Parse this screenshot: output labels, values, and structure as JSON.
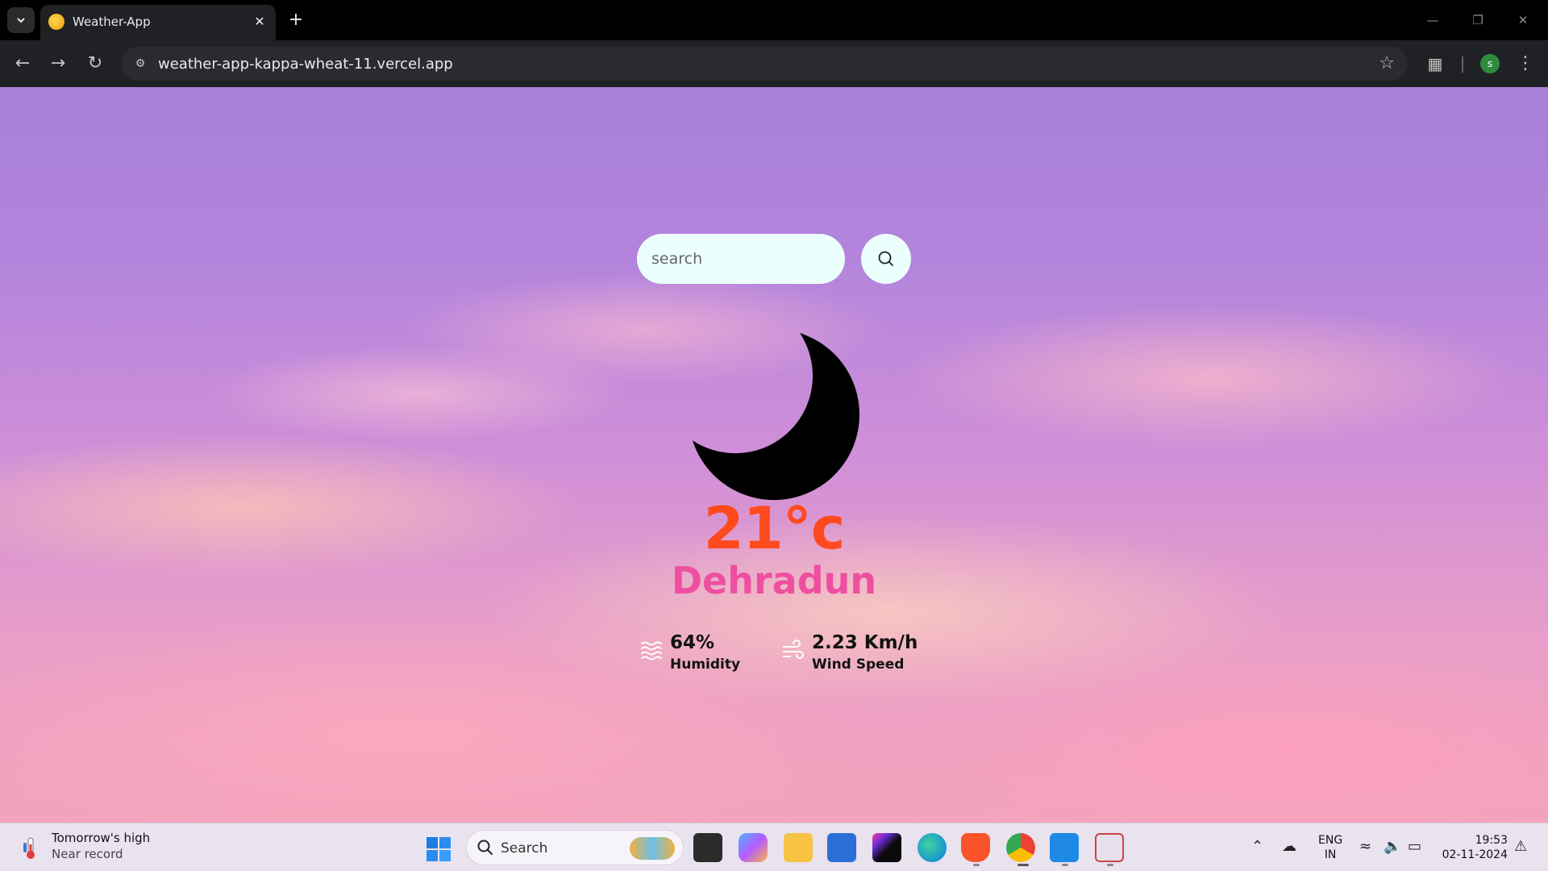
{
  "browser": {
    "tab_title": "Weather-App",
    "url": "weather-app-kappa-wheat-11.vercel.app",
    "profile_initial": "S",
    "new_tab_glyph": "+",
    "tab_close_glyph": "✕"
  },
  "weather": {
    "search_placeholder": "search",
    "temperature": "21°c",
    "city": "Dehradun",
    "humidity_value": "64%",
    "humidity_label": "Humidity",
    "wind_value": "2.23 Km/h",
    "wind_label": "Wind Speed",
    "condition_icon": "moon-icon",
    "colors": {
      "temperature": "#ff4a1e",
      "city": "#ee4fa0",
      "search_bg": "#ebfffc"
    }
  },
  "taskbar": {
    "widget_title": "Tomorrow's high",
    "widget_subtitle": "Near record",
    "search_label": "Search",
    "lang_line1": "ENG",
    "lang_line2": "IN",
    "time": "19:53",
    "date": "02-11-2024",
    "apps": [
      "task-view-icon",
      "copilot-icon",
      "file-explorer-icon",
      "microsoft-store-icon",
      "intellij-icon",
      "edge-icon",
      "brave-icon",
      "chrome-icon",
      "vscode-icon",
      "snipping-tool-icon"
    ]
  }
}
